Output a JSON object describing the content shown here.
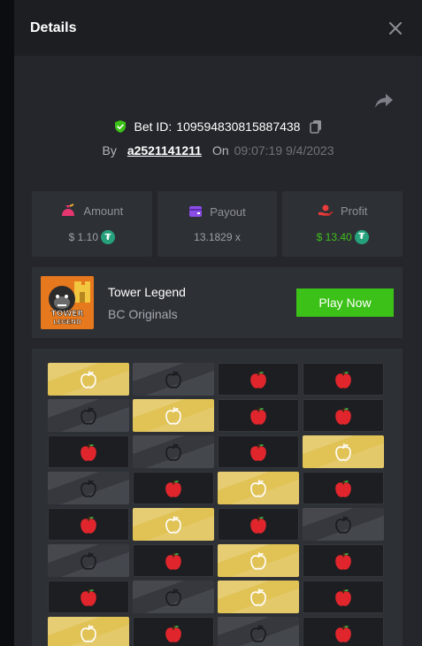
{
  "modal": {
    "title": "Details"
  },
  "bet": {
    "id_label": "Bet ID:",
    "id": "109594830815887438",
    "by_label": "By",
    "user": "a2521141211",
    "on_label": "On",
    "datetime": "09:07:19 9/4/2023"
  },
  "stats": {
    "amount": {
      "label": "Amount",
      "value": "$ 1.10",
      "currency_icon": "tether-icon"
    },
    "payout": {
      "label": "Payout",
      "value": "13.1829 x"
    },
    "profit": {
      "label": "Profit",
      "value": "$ 13.40",
      "currency_icon": "tether-icon"
    }
  },
  "game": {
    "name": "Tower Legend",
    "provider": "BC Originals",
    "play_label": "Play Now",
    "thumb_text": [
      "TOWER",
      "LEGEND"
    ]
  },
  "board": {
    "rows": [
      [
        "gold",
        "bomb",
        "dark",
        "dark"
      ],
      [
        "bomb",
        "gold",
        "dark",
        "dark"
      ],
      [
        "dark",
        "bomb",
        "dark",
        "gold"
      ],
      [
        "bomb",
        "dark",
        "gold",
        "dark"
      ],
      [
        "dark",
        "gold",
        "dark",
        "bomb"
      ],
      [
        "bomb",
        "dark",
        "gold",
        "dark"
      ],
      [
        "dark",
        "bomb",
        "gold",
        "dark"
      ],
      [
        "gold",
        "dark",
        "bomb",
        "dark"
      ]
    ]
  },
  "colors": {
    "accent_green": "#3bc117",
    "tile_gold": "#e0c255",
    "apple_red": "#e0262c",
    "tether": "#26a17b"
  }
}
